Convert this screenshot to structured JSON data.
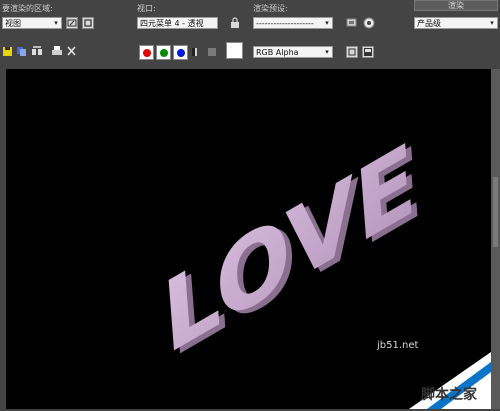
{
  "toolbar_top": {
    "region_label": "要渲染的区域:",
    "viewport_label": "视口:",
    "preset_label": "渲染预设:",
    "render_button": "渲染",
    "region_value": "视图",
    "viewport_value": "四元菜单 4 - 透视",
    "preset_value": "--------------------",
    "quality_value": "产品级"
  },
  "toolbar_second": {
    "channel_value": "RGB Alpha",
    "colors": {
      "red": "#e00000",
      "green": "#008a00",
      "blue": "#0018e0"
    }
  },
  "viewport": {
    "text": "LOVE",
    "text_color": "#c7a7cd",
    "background": "#000000"
  },
  "watermark": {
    "url": "jb51.net",
    "brand": "脚本之家"
  }
}
